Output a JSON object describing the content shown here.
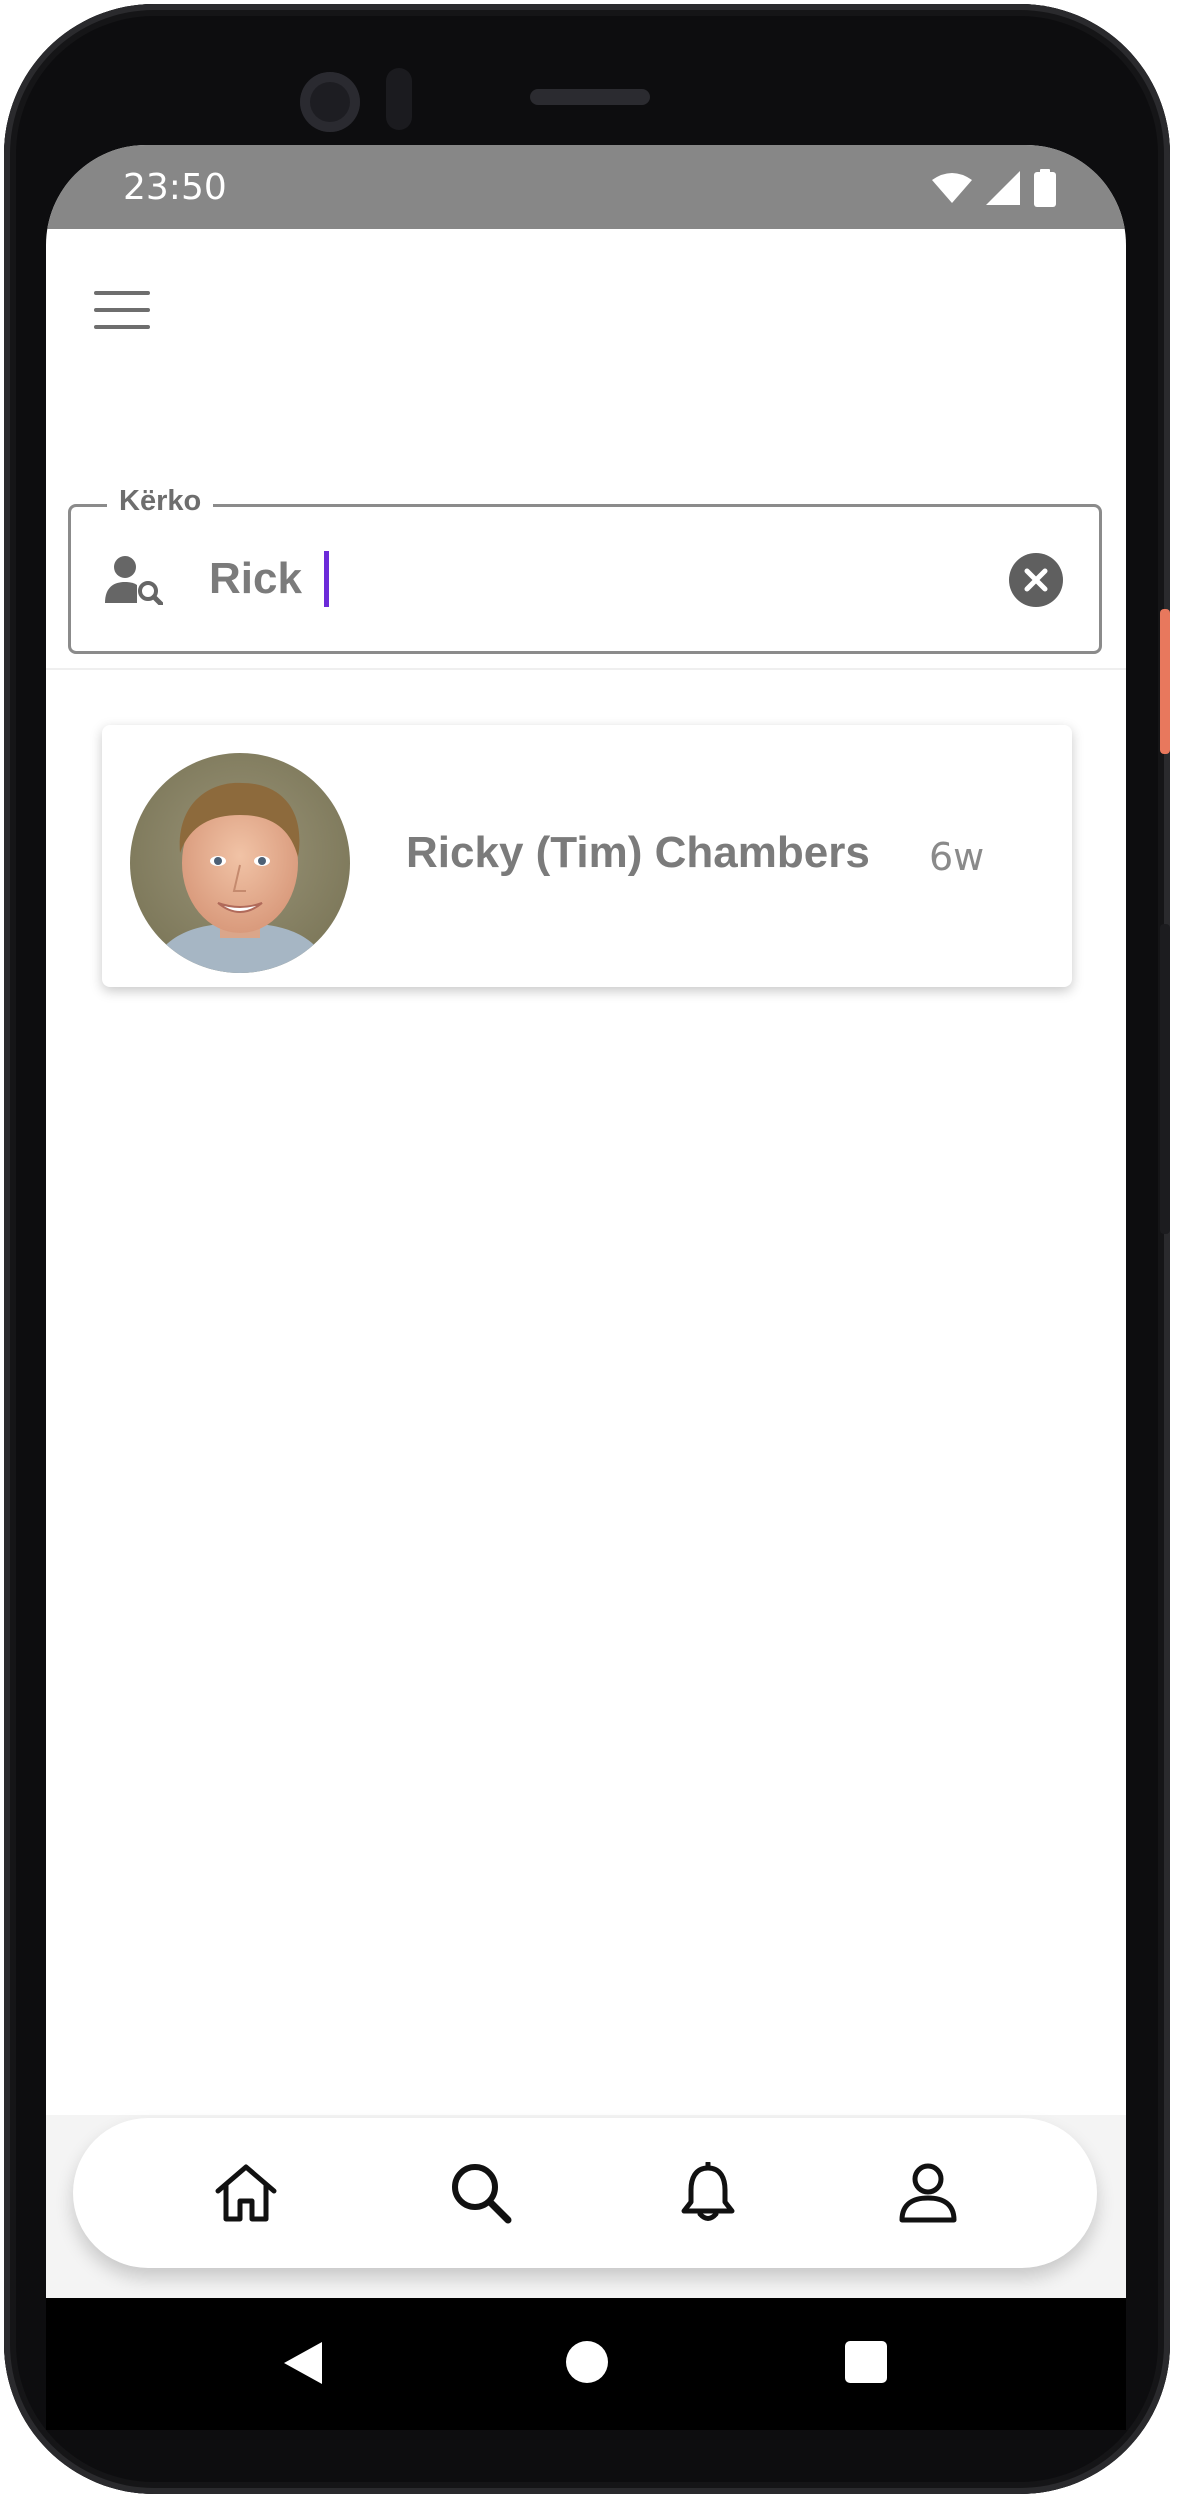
{
  "status_bar": {
    "time": "23:50",
    "icons": [
      "wifi-icon",
      "cellular-signal-icon",
      "battery-icon"
    ],
    "background": "#878787"
  },
  "header": {
    "menu_icon": "hamburger-menu-icon"
  },
  "search": {
    "label": "Kërko",
    "value": "Rick",
    "leading_icon": "person-search-icon",
    "trailing_icon": "clear-icon",
    "caret_color": "#6c2bd9"
  },
  "results": [
    {
      "name": "Ricky (Tim) Chambers",
      "time": "6w",
      "avatar": "person-avatar-photo"
    }
  ],
  "bottom_nav": {
    "items": [
      {
        "icon": "home-icon"
      },
      {
        "icon": "search-icon"
      },
      {
        "icon": "bell-icon"
      },
      {
        "icon": "profile-icon"
      }
    ]
  },
  "system_nav": {
    "items": [
      "back-icon",
      "home-circle-icon",
      "recents-square-icon"
    ]
  }
}
